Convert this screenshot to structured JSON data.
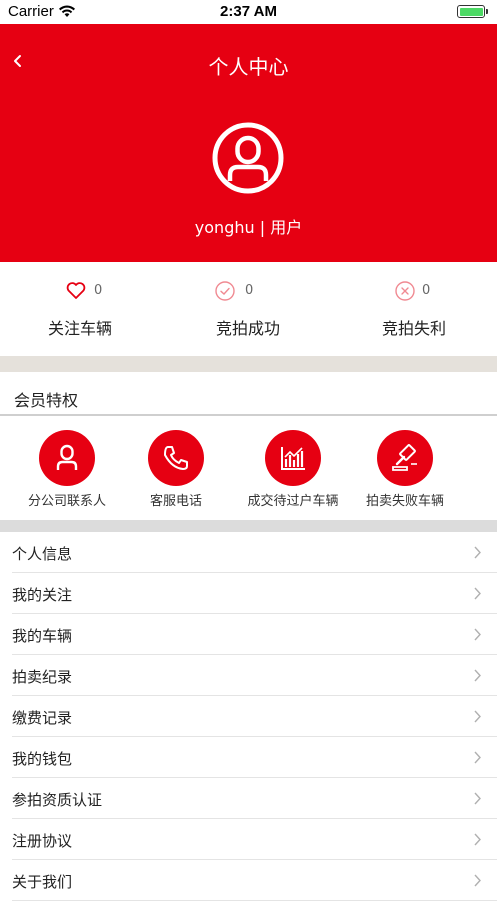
{
  "status_bar": {
    "carrier": "Carrier",
    "time": "2:37 AM",
    "battery_level": 1.0
  },
  "header": {
    "title": "个人中心",
    "username": "yonghu | 用户"
  },
  "stats": [
    {
      "icon": "heart-icon",
      "count": "0",
      "label": "关注车辆"
    },
    {
      "icon": "check-circle-icon",
      "count": "0",
      "label": "竞拍成功"
    },
    {
      "icon": "x-circle-icon",
      "count": "0",
      "label": "竞拍失利"
    }
  ],
  "member_section": {
    "title": "会员特权"
  },
  "perks": [
    {
      "icon": "person-icon",
      "label": "分公司联系人"
    },
    {
      "icon": "phone-icon",
      "label": "客服电话"
    },
    {
      "icon": "chart-icon",
      "label": "成交待过户车辆"
    },
    {
      "icon": "gavel-icon",
      "label": "拍卖失败车辆"
    }
  ],
  "menu": [
    "个人信息",
    "我的关注",
    "我的车辆",
    "拍卖纪录",
    "缴费记录",
    "我的钱包",
    "参拍资质认证",
    "注册协议",
    "关于我们"
  ],
  "colors": {
    "brand_red": "#e60012",
    "section_gap": "#e5e1db"
  }
}
